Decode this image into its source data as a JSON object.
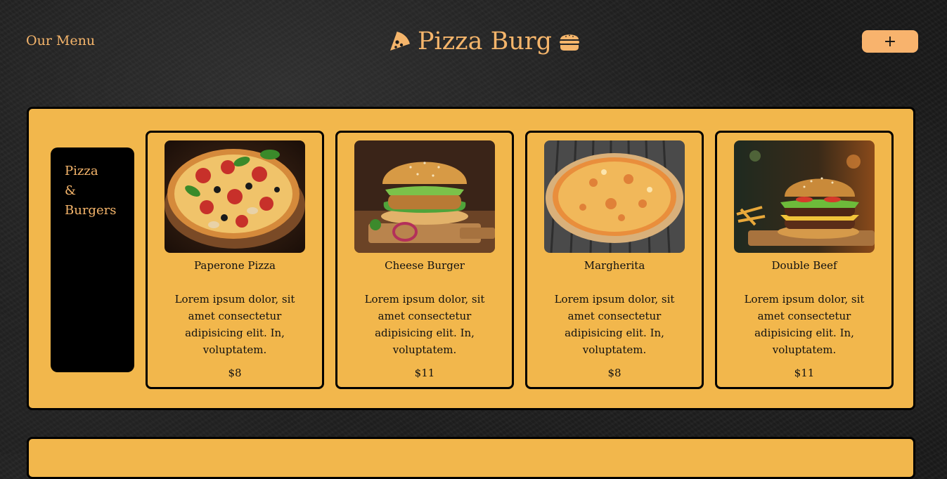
{
  "header": {
    "menu_label": "Our Menu",
    "brand_title": "Pizza Burg",
    "brand_icon_left": "pizza-slice-icon",
    "brand_icon_right": "burger-icon",
    "add_button_label": "+"
  },
  "category": {
    "lines": [
      "Pizza",
      "&",
      "Burgers"
    ]
  },
  "items": [
    {
      "name": "Paperone Pizza",
      "description": "Lorem ipsum dolor, sit amet consectetur adipisicing elit. In, voluptatem.",
      "price": "$8",
      "image": "pizza-pepperoni-photo"
    },
    {
      "name": "Cheese Burger",
      "description": "Lorem ipsum dolor, sit amet consectetur adipisicing elit. In, voluptatem.",
      "price": "$11",
      "image": "cheese-burger-photo"
    },
    {
      "name": "Margherita",
      "description": "Lorem ipsum dolor, sit amet consectetur adipisicing elit. In, voluptatem.",
      "price": "$8",
      "image": "margherita-pizza-photo"
    },
    {
      "name": "Double Beef",
      "description": "Lorem ipsum dolor, sit amet consectetur adipisicing elit. In, voluptatem.",
      "price": "$11",
      "image": "double-beef-burger-photo"
    }
  ],
  "colors": {
    "accent": "#f5b56b",
    "panel": "#f2b74c",
    "button": "#f8b36d",
    "background": "#1b1b1b"
  }
}
